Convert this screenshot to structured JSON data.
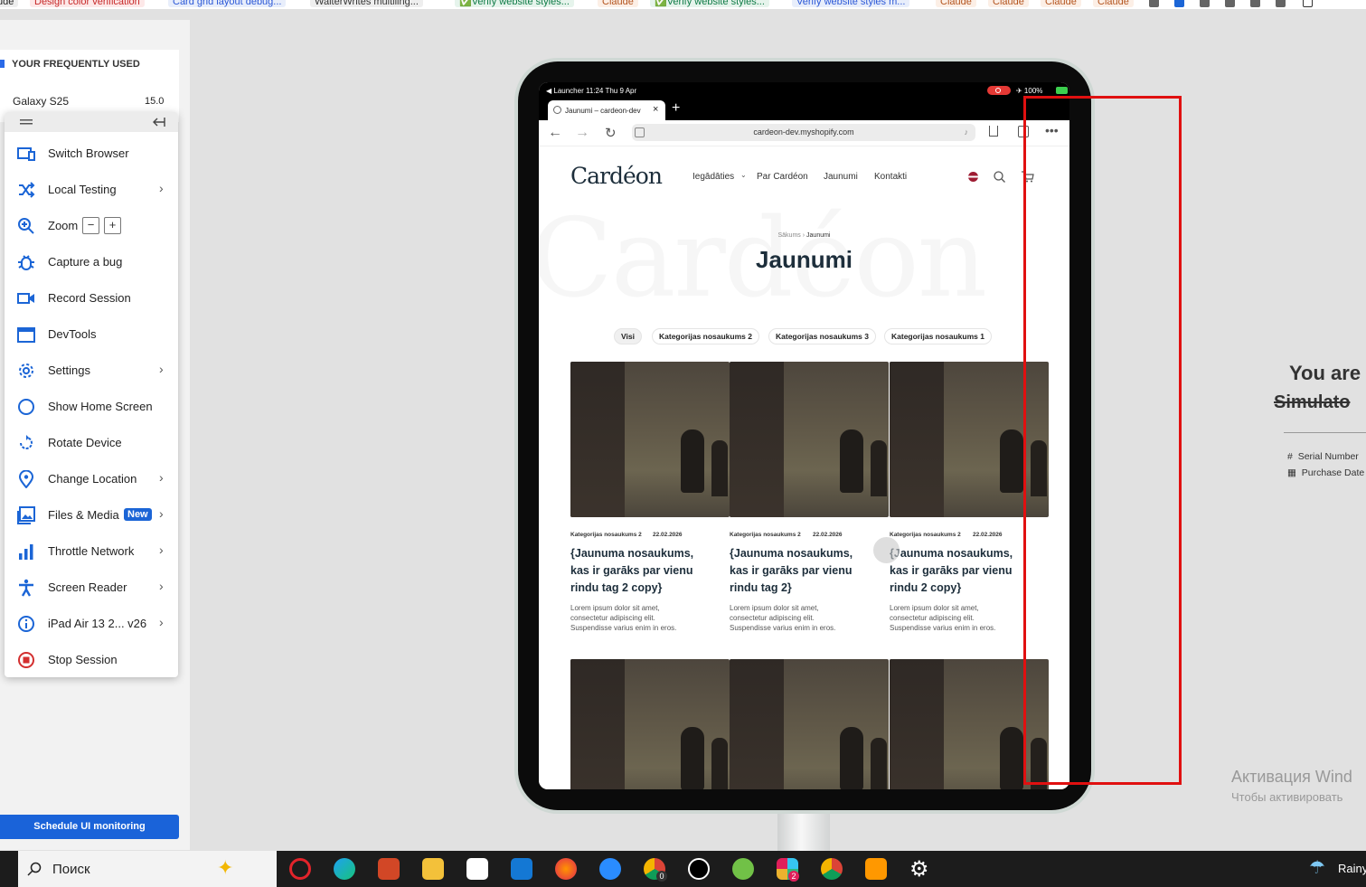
{
  "bookmarks": [
    {
      "label": "ude",
      "color": "#222"
    },
    {
      "label": "Design color verification",
      "color": "#c62828"
    },
    {
      "label": "Card grid layout debug...",
      "color": "#2a57d6"
    },
    {
      "label": "WalterWrites multiling...",
      "color": "#333"
    },
    {
      "label": "✅Verify website styles...",
      "color": "#0d7a45"
    },
    {
      "label": "Claude",
      "color": "#b3541e"
    },
    {
      "label": "✅Verify website styles...",
      "color": "#0d7a45"
    },
    {
      "label": "Verify website styles m...",
      "color": "#2a57d6"
    },
    {
      "label": "Claude",
      "color": "#b3541e"
    },
    {
      "label": "Claude",
      "color": "#b3541e"
    },
    {
      "label": "Claude",
      "color": "#b3541e"
    },
    {
      "label": "Claude",
      "color": "#b3541e"
    }
  ],
  "left_panel": {
    "section_title": "YOUR FREQUENTLY USED",
    "device_name": "Galaxy S25",
    "device_version": "15.0",
    "schedule_button": "Schedule UI monitoring"
  },
  "menu": {
    "items": [
      {
        "label": "Switch Browser",
        "icon": "switch-browser-icon",
        "chevron": false
      },
      {
        "label": "Local Testing",
        "icon": "shuffle-icon",
        "chevron": true
      },
      {
        "label": "Zoom",
        "icon": "zoom-icon",
        "chevron": false
      },
      {
        "label": "Capture a bug",
        "icon": "bug-icon",
        "chevron": false
      },
      {
        "label": "Record Session",
        "icon": "video-camera-icon",
        "chevron": false
      },
      {
        "label": "DevTools",
        "icon": "devtools-window-icon",
        "chevron": false
      },
      {
        "label": "Settings",
        "icon": "gear-icon",
        "chevron": true
      },
      {
        "label": "Show Home Screen",
        "icon": "circle-icon",
        "chevron": false
      },
      {
        "label": "Rotate Device",
        "icon": "rotate-icon",
        "chevron": false
      },
      {
        "label": "Change Location",
        "icon": "location-pin-icon",
        "chevron": true
      },
      {
        "label": "Files & Media",
        "icon": "image-icon",
        "chevron": true
      },
      {
        "label": "Throttle Network",
        "icon": "signal-bars-icon",
        "chevron": true
      },
      {
        "label": "Screen Reader",
        "icon": "accessibility-icon",
        "chevron": true
      },
      {
        "label": "iPad Air 13 2... v26",
        "icon": "info-icon",
        "chevron": true
      },
      {
        "label": "Stop Session",
        "icon": "stop-icon",
        "chevron": false
      }
    ],
    "zoom_minus": "−",
    "zoom_plus": "+",
    "new_badge": "New",
    "accent": "#1b65d6"
  },
  "ipad": {
    "status_left": "◀ Launcher  11:24  Thu 9 Apr",
    "status_right": "✈ 100%",
    "tab_title": "Jaunumi – cardeon-dev",
    "url": "cardeon-dev.myshopify.com"
  },
  "site": {
    "logo": "Cardéon",
    "nav": [
      "Iegādāties",
      "Par Cardéon",
      "Jaunumi",
      "Kontakti"
    ],
    "watermark": "Cardéon",
    "breadcrumb": [
      "Sākums",
      "›",
      "Jaunumi"
    ],
    "heading": "Jaunumi",
    "filters": [
      "Visi",
      "Kategorijas nosaukums 2",
      "Kategorijas nosaukums 3",
      "Kategorijas nosaukums 1"
    ],
    "cards": [
      {
        "category": "Kategorijas nosaukums 2",
        "date": "22.02.2026",
        "title": "{Jaunuma nosaukums, kas ir garāks par vienu rindu tag 2 copy}",
        "excerpt": "Lorem ipsum dolor sit amet, consectetur adipiscing elit. Suspendisse varius enim in eros."
      },
      {
        "category": "Kategorijas nosaukums 2",
        "date": "22.02.2026",
        "title": "{Jaunuma nosaukums, kas ir garāks par vienu rindu tag 2}",
        "excerpt": "Lorem ipsum dolor sit amet, consectetur adipiscing elit. Suspendisse varius enim in eros."
      },
      {
        "category": "Kategorijas nosaukums 2",
        "date": "22.02.2026",
        "title": "{Jaunuma nosaukums, kas ir garāks par vienu rindu 2 copy}",
        "excerpt": "Lorem ipsum dolor sit amet, consectetur adipiscing elit. Suspendisse varius enim in eros."
      }
    ]
  },
  "right_panel": {
    "title_line1": "You are",
    "title_line2": "Simulato",
    "serial_label": "Serial Number",
    "purchase_label": "Purchase Date",
    "hash": "#",
    "calendar": "▦"
  },
  "activation": {
    "line1": "Активация Wind",
    "line2": "Чтобы активировать"
  },
  "taskbar": {
    "search_text": "Поиск",
    "weather": "Rainy",
    "badge1": "0",
    "badge2": "2",
    "apps": [
      "opera-icon",
      "edge-icon",
      "powerpoint-icon",
      "explorer-icon",
      "store-icon",
      "outlook-icon",
      "firefox-icon",
      "app-icon",
      "chrome-icon",
      "upwork-icon",
      "utorrent-icon",
      "slack-icon",
      "chrome-profile-icon",
      "sublime-icon",
      "settings-gear-icon"
    ]
  }
}
